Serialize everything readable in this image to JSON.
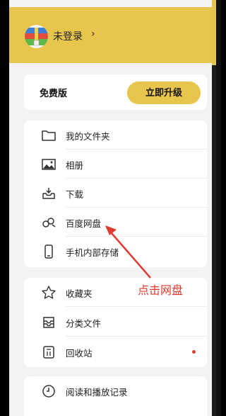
{
  "header": {
    "login_text": "未登录",
    "chevron": "›"
  },
  "plan": {
    "label": "免费版",
    "upgrade_label": "立即升级"
  },
  "section1": [
    {
      "label": "我的文件夹",
      "icon": "folder-icon"
    },
    {
      "label": "相册",
      "icon": "photo-icon"
    },
    {
      "label": "下载",
      "icon": "download-tray-icon"
    },
    {
      "label": "百度网盘",
      "icon": "baidu-netdisk-icon"
    },
    {
      "label": "手机内部存储",
      "icon": "phone-icon"
    }
  ],
  "section2": [
    {
      "label": "收藏夹",
      "icon": "star-icon"
    },
    {
      "label": "分类文件",
      "icon": "category-box-icon"
    },
    {
      "label": "回收站",
      "icon": "trash-icon",
      "badge_dot": true
    }
  ],
  "section3": [
    {
      "label": "阅读和播放记录",
      "icon": "clock-icon"
    }
  ],
  "annotation": {
    "text": "点击网盘",
    "color": "#e03a30"
  },
  "colors": {
    "accent": "#e8c54c",
    "background": "#f3f3f3",
    "badge": "#e03a30"
  }
}
